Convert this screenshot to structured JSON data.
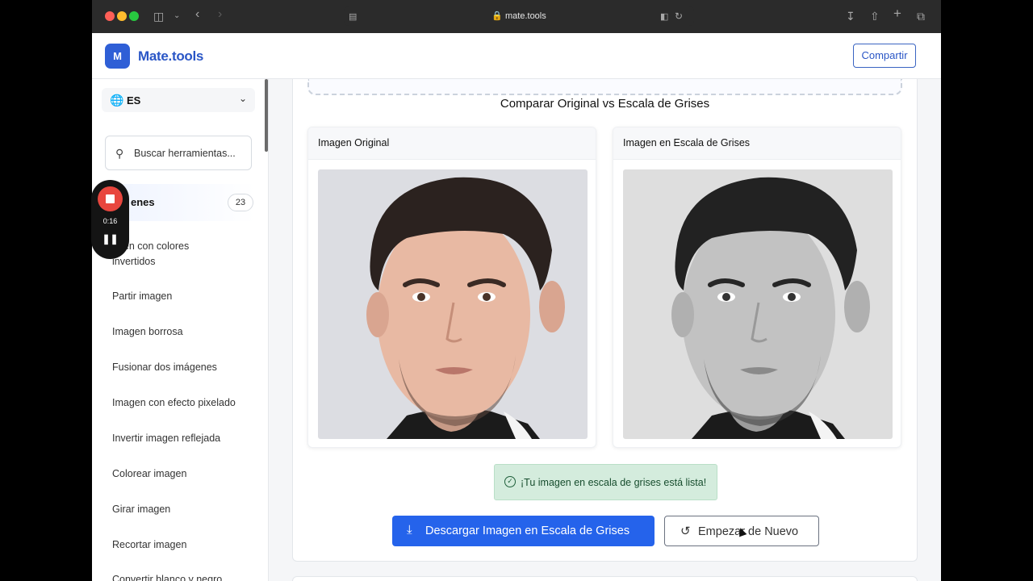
{
  "browser": {
    "url": "mate.tools"
  },
  "header": {
    "logo_letter": "M",
    "logo_text": "Mate.tools",
    "share_label": "Compartir"
  },
  "sidebar": {
    "language": "ES",
    "search_placeholder": "Buscar herramientas...",
    "category": {
      "label": "enes",
      "count": "23"
    },
    "items": [
      {
        "label": "agen con colores invertidos"
      },
      {
        "label": "Partir imagen"
      },
      {
        "label": "Imagen borrosa"
      },
      {
        "label": "Fusionar dos imágenes"
      },
      {
        "label": "Imagen con efecto pixelado"
      },
      {
        "label": "Invertir imagen reflejada"
      },
      {
        "label": "Colorear imagen"
      },
      {
        "label": "Girar imagen"
      },
      {
        "label": "Recortar imagen"
      },
      {
        "label": "Convertir blanco y negro"
      }
    ]
  },
  "recorder": {
    "time": "0:16"
  },
  "main": {
    "compare_title": "Comparar Original vs Escala de Grises",
    "original_title": "Imagen Original",
    "grayscale_title": "Imagen en Escala de Grises",
    "success_message": "¡Tu imagen en escala de grises está lista!",
    "download_label": "Descargar Imagen en Escala de Grises",
    "restart_label": "Empezar de Nuevo"
  }
}
